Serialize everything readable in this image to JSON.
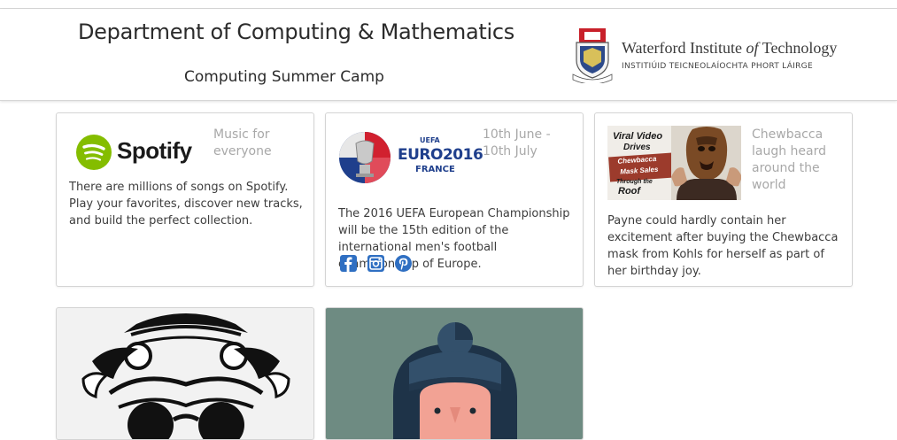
{
  "header": {
    "title": "Department of Computing & Mathematics",
    "subtitle": "Computing Summer Camp",
    "logo": {
      "name": "Waterford Institute of Technology",
      "name_prefix": "Waterford Institute ",
      "name_of": "of",
      "name_suffix": " Technology",
      "irish_name": "INSTITIÚID TEICNEOLAÍOCHTA PHORT LÁIRGE"
    }
  },
  "cards": [
    {
      "image": "Spotify",
      "aside": "Music for everyone",
      "text": "There are millions of songs on Spotify. Play your favorites, discover new tracks, and build the perfect collection."
    },
    {
      "image_caption": "UEFA EURO2016 FRANCE",
      "image_lines": [
        "UEFA",
        "EURO2016",
        "FRANCE"
      ],
      "aside": "10th June - 10th July",
      "text": "The 2016 UEFA European Championship will be the 15th edition of the international men's football championship of Europe.",
      "social_icons": [
        "facebook-icon",
        "instagram-icon",
        "pinterest-icon"
      ]
    },
    {
      "image_lines": [
        "Viral Video",
        "Drives",
        "Chewbacca",
        "Mask Sales",
        "Through the",
        "Roof"
      ],
      "aside": "Chewbacca laugh heard around the world",
      "text": "Payne could hardly contain her excitement after buying the Chewbacca mask from Kohls for herself as part of her birthday joy."
    },
    {
      "image": "ornate-illustration"
    },
    {
      "image": "character-illustration"
    }
  ],
  "colors": {
    "social_blue": "#2f6fc2",
    "spotify_green": "#84bd00",
    "card_teal": "#6e8b82"
  }
}
